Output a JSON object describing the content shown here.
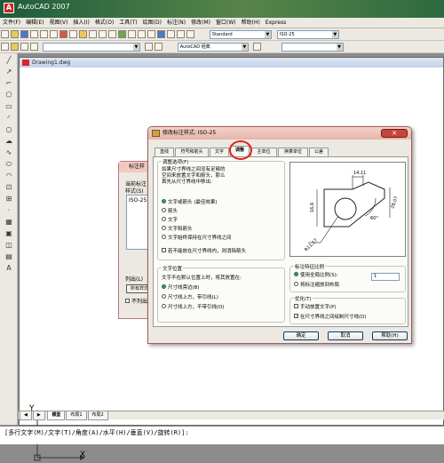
{
  "window": {
    "title": "AutoCAD 2007"
  },
  "menu": [
    "文件(F)",
    "编辑(E)",
    "视图(V)",
    "插入(I)",
    "格式(O)",
    "工具(T)",
    "绘图(D)",
    "标注(N)",
    "修改(M)",
    "窗口(W)",
    "帮助(H)",
    "Express"
  ],
  "toolbar": {
    "style_combo": "Standard",
    "dimstyle_combo": "ISO-25",
    "workspace_combo": "AutoCAD 经典"
  },
  "drawing": {
    "tab_title": "Drawing1.dwg",
    "axis_x": "X",
    "axis_y": "Y",
    "layout_tabs": [
      "模型",
      "布局1",
      "布局2"
    ]
  },
  "command": {
    "line": "[多行文字(M)/文字(T)/角度(A)/水平(H)/垂直(V)/旋转(R)]:"
  },
  "back_dialog": {
    "title": "标注样",
    "label1": "当前标注",
    "label2": "样式(S)",
    "list_item": "ISO-25",
    "label3": "列出(L)",
    "button": "所有样式",
    "check": "不列出"
  },
  "dialog": {
    "title": "修改标注样式: ISO-25",
    "tabs": [
      "直线",
      "符号和箭头",
      "文字",
      "调整",
      "主单位",
      "换算单位",
      "公差"
    ],
    "fit": {
      "title": "调整选项(F)",
      "desc": "如果尺寸界线之间没有足够的空间来放置文字和箭头，那么首先从尺寸界线中移出:",
      "options": [
        "文字或箭头 (最佳效果)",
        "箭头",
        "文字",
        "文字和箭头",
        "文字始终保持在尺寸界线之间"
      ],
      "suppress": "若不能放在尺寸界线内，则消除箭头"
    },
    "text_pos": {
      "title": "文字位置",
      "desc": "文字不在默认位置上时，将其放置在:",
      "options": [
        "尺寸线旁边(B)",
        "尺寸线上方，带引线(L)",
        "尺寸线上方，不带引线(O)"
      ]
    },
    "scale": {
      "title": "标注特征比例",
      "options": [
        "使用全局比例(S):",
        "将标注缩放到布局"
      ],
      "value": "1"
    },
    "finetune": {
      "title": "优化(T)",
      "options": [
        "手动放置文字(P)",
        "在尺寸界线之间绘制尺寸线(D)"
      ],
      "checked": [
        false,
        true
      ]
    },
    "preview": {
      "dims": [
        "14,11",
        "16,6",
        "28,07",
        "60°",
        "R11,17"
      ]
    },
    "buttons": {
      "ok": "确定",
      "cancel": "取消",
      "help": "帮助(H)"
    }
  }
}
